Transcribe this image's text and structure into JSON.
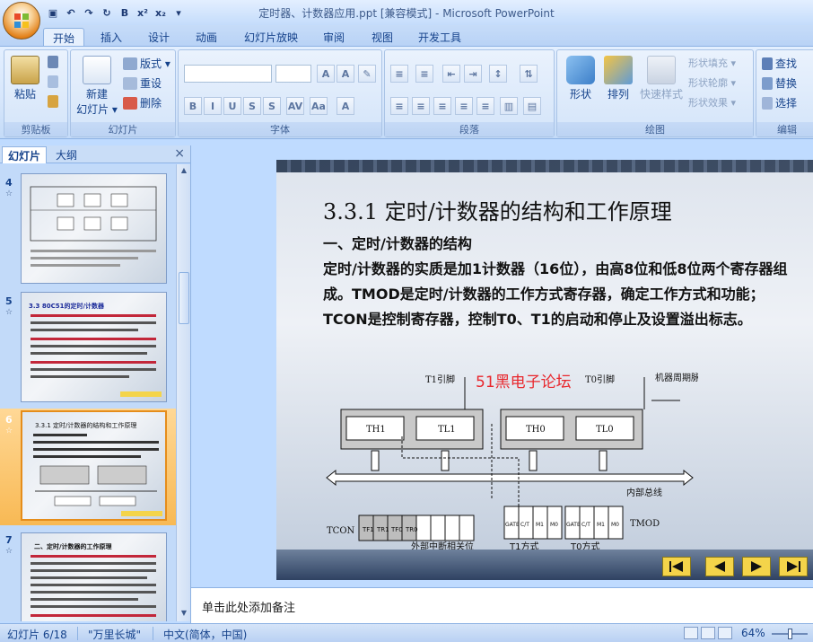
{
  "window": {
    "title": "定时器、计数器应用.ppt [兼容模式] - Microsoft PowerPoint"
  },
  "tabs": [
    "开始",
    "插入",
    "设计",
    "动画",
    "幻灯片放映",
    "审阅",
    "视图",
    "开发工具"
  ],
  "ribbon": {
    "clipboard": {
      "label": "剪贴板",
      "paste": "粘贴"
    },
    "slides": {
      "label": "幻灯片",
      "new_slide_line1": "新建",
      "new_slide_line2": "幻灯片 ▾",
      "layout": "版式 ▾",
      "reset": "重设",
      "delete": "删除"
    },
    "font": {
      "label": "字体"
    },
    "paragraph": {
      "label": "段落"
    },
    "drawing": {
      "label": "绘图",
      "shapes": "形状",
      "arrange": "排列",
      "quick_styles": "快速样式",
      "fill": "形状填充 ▾",
      "outline": "形状轮廓 ▾",
      "effects": "形状效果 ▾"
    },
    "editing": {
      "label": "编辑",
      "find": "查找",
      "replace": "替换",
      "select": "选择"
    }
  },
  "left_panel": {
    "tab_slides": "幻灯片",
    "tab_outline": "大纲",
    "close": "×"
  },
  "thumbnails": [
    {
      "num": "4",
      "title": "",
      "selected": false
    },
    {
      "num": "5",
      "title": "3.3 80C51的定时/计数器",
      "selected": false
    },
    {
      "num": "6",
      "title": "3.3.1 定时/计数器的结构和工作原理",
      "selected": true
    },
    {
      "num": "7",
      "title": "二、定时/计数器的工作原理",
      "selected": false
    }
  ],
  "slide": {
    "title": "3.3.1 定时/计数器的结构和工作原理",
    "subtitle": "一、定时/计数器的结构",
    "body": "定时/计数器的实质是加1计数器（16位），由高8位和低8位两个寄存器组成。TMOD是定时/计数器的工作方式寄存器，确定工作方式和功能；TCON是控制寄存器，控制T0、T1的启动和停止及设置溢出标志。",
    "watermark": "51黑电子论坛",
    "diagram": {
      "t1_pin": "T1引脚",
      "t0_pin": "T0引脚",
      "machine_cycle": "机器周期脉冲",
      "th1": "TH1",
      "tl1": "TL1",
      "th0": "TH0",
      "tl0": "TL0",
      "bus": "内部总线",
      "tcon": "TCON",
      "tmod": "TMOD",
      "tcon_bits": [
        "TF1",
        "TR1",
        "TF0",
        "TR0"
      ],
      "tmod_bits": [
        "GATE",
        "C/T",
        "M1",
        "M0",
        "GATE",
        "C/T",
        "M1",
        "M0"
      ],
      "external_interrupt": "外部中断相关位",
      "t1_mode": "T1方式",
      "t0_mode": "T0方式"
    }
  },
  "notes": {
    "placeholder": "单击此处添加备注"
  },
  "status": {
    "slide_count": "幻灯片 6/18",
    "theme": "\"万里长城\"",
    "language": "中文(简体，中国)",
    "zoom": "64%"
  }
}
